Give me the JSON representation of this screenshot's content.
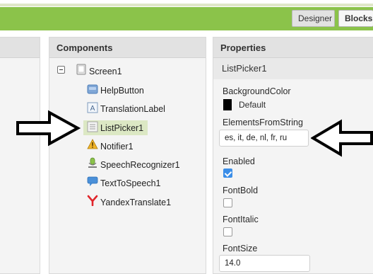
{
  "toolbar": {
    "designer_label": "Designer",
    "blocks_label": "Blocks",
    "accent_color": "#8bc34a"
  },
  "components_panel": {
    "title": "Components",
    "items": [
      {
        "label": "Screen1",
        "icon": "screen-icon",
        "expanded": true
      },
      {
        "label": "HelpButton",
        "icon": "button-icon"
      },
      {
        "label": "TranslationLabel",
        "icon": "label-icon"
      },
      {
        "label": "ListPicker1",
        "icon": "listpicker-icon",
        "selected": true
      },
      {
        "label": "Notifier1",
        "icon": "notifier-icon"
      },
      {
        "label": "SpeechRecognizer1",
        "icon": "speech-recognizer-icon"
      },
      {
        "label": "TextToSpeech1",
        "icon": "text-to-speech-icon"
      },
      {
        "label": "YandexTranslate1",
        "icon": "yandex-translate-icon"
      }
    ]
  },
  "properties_panel": {
    "title": "Properties",
    "component_name": "ListPicker1",
    "background_color": {
      "label": "BackgroundColor",
      "value": "Default",
      "swatch": "#000000"
    },
    "elements_from_string": {
      "label": "ElementsFromString",
      "value": "es, it, de, nl, fr, ru"
    },
    "enabled": {
      "label": "Enabled",
      "checked": true
    },
    "font_bold": {
      "label": "FontBold",
      "checked": false
    },
    "font_italic": {
      "label": "FontItalic",
      "checked": false
    },
    "font_size": {
      "label": "FontSize",
      "value": "14.0"
    }
  }
}
